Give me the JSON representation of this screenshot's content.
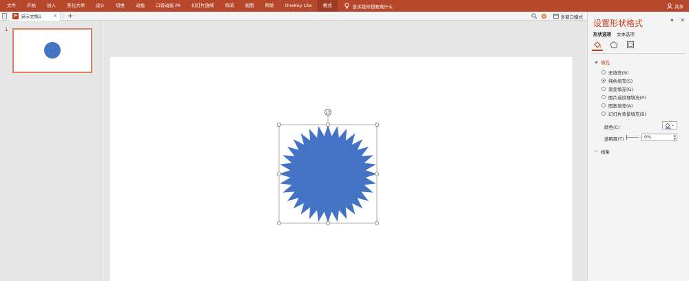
{
  "ribbon": {
    "tabs": [
      {
        "label": "文件"
      },
      {
        "label": "开始"
      },
      {
        "label": "插入"
      },
      {
        "label": "美化大师"
      },
      {
        "label": "设计"
      },
      {
        "label": "切换"
      },
      {
        "label": "动画"
      },
      {
        "label": "口袋动画 PA"
      },
      {
        "label": "幻灯片放映"
      },
      {
        "label": "审阅"
      },
      {
        "label": "视图"
      },
      {
        "label": "帮助"
      },
      {
        "label": "OneKey Lite"
      },
      {
        "label": "格式"
      }
    ],
    "active_tab": "格式",
    "tell_me": "告诉我你想要做什么",
    "share": "共享"
  },
  "docbar": {
    "doc_title": "演示文稿1",
    "close": "×",
    "plus": "+",
    "multi_window": "多窗口模式"
  },
  "thumbnails": {
    "slide_number": "1"
  },
  "format_pane": {
    "title": "设置形状格式",
    "tab_shape": "形状选项",
    "tab_text": "文本选项",
    "fill_section": "填充",
    "fill_options": [
      {
        "label": "无填充(N)",
        "checked": false
      },
      {
        "label": "纯色填充(S)",
        "checked": true
      },
      {
        "label": "渐变填充(G)",
        "checked": false
      },
      {
        "label": "图片或纹理填充(P)",
        "checked": false
      },
      {
        "label": "图案填充(A)",
        "checked": false
      },
      {
        "label": "幻灯片背景填充(B)",
        "checked": false
      }
    ],
    "color_label": "颜色(C)",
    "transparency_label": "透明度(T)",
    "transparency_value": "0%",
    "line_section": "线条"
  },
  "colors": {
    "ribbon_bg": "#b7472a",
    "accent": "#c43e1c",
    "shape_fill": "#4472c4"
  },
  "icons": [
    "search-icon",
    "lightbulb-icon",
    "user-icon",
    "fill-bucket-icon",
    "pentagon-icon",
    "size-icon",
    "rotate-handle-icon",
    "close-icon",
    "dropdown-icon"
  ]
}
